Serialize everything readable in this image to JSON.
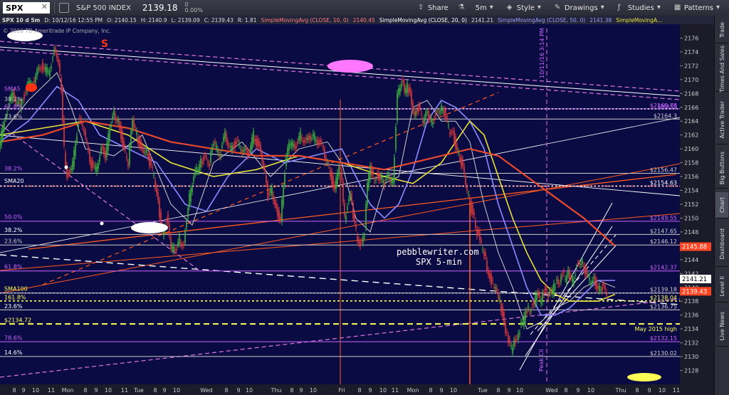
{
  "toolbar": {
    "symbol": "SPX",
    "index_name": "S&P 500 INDEX",
    "last_price": "2139.18",
    "change_abs": "0",
    "change_pct": "0.00%",
    "buttons": [
      {
        "label": "Share",
        "icon": "share-icon"
      },
      {
        "label": "",
        "icon": "flask-icon"
      },
      {
        "label": "5m",
        "icon": "timeframe-icon"
      },
      {
        "label": "Style",
        "icon": "style-icon"
      },
      {
        "label": "Drawings",
        "icon": "drawings-icon"
      },
      {
        "label": "Studies",
        "icon": "studies-icon"
      },
      {
        "label": "Patterns",
        "icon": "patterns-icon"
      }
    ]
  },
  "legend": {
    "title": "SPX 10 d 5m",
    "date": "D: 10/12/16 12:55 PM",
    "open": "O: 2140.15",
    "high": "H: 2140.9",
    "low": "L: 2139.09",
    "close": "C: 2139.43",
    "range": "R: 1.81",
    "sma10": "SimpleMovingAvg (CLOSE, 10, 0)",
    "sma10_val": "2140.45",
    "sma20": "SimpleMovingAvg (CLOSE, 20, 0)",
    "sma20_val": "2141.21",
    "sma50": "SimpleMovingAvg (CLOSE, 50, 0)",
    "sma50_val": "2141.38",
    "sma100": "SimpleMovingA...",
    "copyright": "© 2016 TD Ameritrade IP Company, Inc."
  },
  "sidebar_tabs": [
    "Trade",
    "Times And Sales",
    "Active Trader",
    "Big Buttons",
    "Chart",
    "Dashboard",
    "Level II",
    "Live News"
  ],
  "sidebar_active": "Chart",
  "annotations": {
    "s_label": "S",
    "watermark": "pebblewriter.com",
    "subtitle": "SPX 5-min",
    "vline_label": "10/11/16 3:14 PM",
    "peak_label": "Peak Cli",
    "fib_618_left": "61.8%",
    "fib_50_left": "50.0%",
    "fib_382_left": "38.2%",
    "fib_236_left": "23.6%",
    "fib_236_left_b": "23.6%",
    "fib_618_left_b": "61.8%",
    "fib_1618_left": "161.8%",
    "fib_786_left": "78.6%",
    "fib_146_left": "14.6%",
    "fib_382_left_b": "38.2%",
    "fib_236_left_c": "23.6%",
    "fib_382_left_c": "38.2%",
    "sma20_label": "SMA20",
    "sma100_label": "SMA100",
    "sma50_label": "SMA5",
    "sma50_label_b": "SMA50",
    "level_2134_left": "$2134.72",
    "may_high": "May 2015 high"
  },
  "colors": {
    "background": "#0e0e4e",
    "candle_up": "#3ab53a",
    "candle_down": "#e03a3a",
    "sma10": "#cccccc",
    "sma20": "#8a8cff",
    "sma50": "#e8e03a",
    "sma100": "#e84a2a",
    "fib": "#cc66ff",
    "accent_yellow": "#ffff55",
    "accent_orange": "#ff5a1e",
    "accent_pink": "#ff66ff"
  },
  "chart_data": {
    "type": "line",
    "title": "SPX 10 d 5m",
    "ylim": [
      2126,
      2178
    ],
    "y_ticks": [
      2128,
      2130,
      2132,
      2134,
      2136,
      2138,
      2140,
      2142,
      2144,
      2146,
      2148,
      2150,
      2152,
      2154,
      2156,
      2158,
      2160,
      2162,
      2164,
      2166,
      2168,
      2170,
      2172,
      2174,
      2176
    ],
    "x_ticks": [
      "8",
      "9",
      "10",
      "11",
      "Mon",
      "8",
      "9",
      "10",
      "11",
      "Tue",
      "8",
      "9",
      "10",
      "Wed",
      "8",
      "9",
      "10",
      "Thu",
      "8",
      "9",
      "10",
      "Fri",
      "8",
      "9",
      "10",
      "11",
      "Mon",
      "8",
      "9",
      "10",
      "Tue",
      "8",
      "9",
      "10",
      "Wed",
      "8",
      "9",
      "10",
      "Thu",
      "8",
      "9",
      "10",
      "11"
    ],
    "x_tick_pos": [
      20,
      33,
      50,
      72,
      95,
      120,
      135,
      152,
      175,
      195,
      218,
      231,
      248,
      290,
      318,
      335,
      350,
      388,
      410,
      423,
      440,
      480,
      505,
      520,
      538,
      555,
      580,
      605,
      620,
      637,
      678,
      700,
      715,
      730,
      775,
      795,
      812,
      830,
      872,
      895,
      912,
      930,
      950
    ],
    "price_series": {
      "name": "SPX",
      "x": [
        0,
        10,
        20,
        30,
        40,
        50,
        60,
        70,
        78,
        84,
        88,
        92,
        96,
        104,
        112,
        120,
        128,
        136,
        144,
        150,
        156,
        162,
        168,
        176,
        182,
        188,
        194,
        200,
        206,
        212,
        218,
        224,
        230,
        236,
        242,
        248,
        254,
        260,
        266,
        272,
        278,
        284,
        290,
        296,
        302,
        310,
        318,
        326,
        334,
        342,
        350,
        358,
        366,
        372,
        378,
        384,
        390,
        396,
        402,
        408,
        416,
        424,
        432,
        440,
        448,
        456,
        464,
        472,
        478,
        482,
        486,
        490,
        494,
        498,
        502,
        506,
        510,
        514,
        518,
        522,
        526,
        530,
        536,
        542,
        548,
        554,
        560,
        566,
        570,
        574,
        578,
        584,
        590,
        596,
        602,
        608,
        614,
        620,
        626,
        632,
        638,
        644,
        650,
        656,
        662,
        668,
        672,
        676,
        680,
        684,
        688,
        692,
        696,
        700,
        704,
        708,
        712,
        716,
        720,
        724,
        728,
        732,
        736,
        740,
        744,
        748,
        752,
        756,
        760,
        764,
        768,
        772,
        776,
        780,
        784,
        788,
        792,
        796,
        800,
        806,
        812,
        818,
        824,
        830,
        836,
        842,
        848,
        854,
        860,
        864
      ],
      "y": [
        2160,
        2165,
        2168,
        2166,
        2169,
        2170,
        2172,
        2171,
        2174,
        2173,
        2168,
        2160,
        2156,
        2158,
        2164,
        2163,
        2158,
        2157,
        2160,
        2159,
        2163,
        2165,
        2164,
        2160,
        2158,
        2164,
        2162,
        2160,
        2160,
        2158,
        2156,
        2152,
        2148,
        2150,
        2146,
        2145,
        2147,
        2146,
        2152,
        2155,
        2157,
        2158,
        2159,
        2158,
        2161,
        2159,
        2162,
        2160,
        2161,
        2160,
        2159,
        2162,
        2160,
        2158,
        2153,
        2154,
        2151,
        2150,
        2157,
        2161,
        2160,
        2162,
        2161,
        2162,
        2161,
        2160,
        2157,
        2154,
        2158,
        2155,
        2150,
        2152,
        2154,
        2150,
        2148,
        2146,
        2147,
        2148,
        2155,
        2157,
        2156,
        2156,
        2156,
        2155,
        2156,
        2155,
        2168,
        2170,
        2168,
        2169,
        2168,
        2165,
        2166,
        2164,
        2165,
        2164,
        2165,
        2166,
        2165,
        2163,
        2162,
        2160,
        2158,
        2155,
        2152,
        2150,
        2148,
        2147,
        2145,
        2144,
        2142,
        2141,
        2140,
        2139,
        2138,
        2136,
        2134,
        2132,
        2131,
        2132,
        2133,
        2134,
        2135,
        2136,
        2137,
        2137,
        2138,
        2139,
        2138,
        2139,
        2140,
        2139,
        2139,
        2140,
        2141,
        2141,
        2142,
        2141,
        2142,
        2141,
        2143,
        2144,
        2142,
        2141,
        2141,
        2140,
        2140,
        2139
      ]
    },
    "series": [
      {
        "name": "SMA10",
        "x": [
          0,
          40,
          80,
          100,
          120,
          160,
          200,
          240,
          270,
          300,
          340,
          380,
          420,
          460,
          480,
          500,
          520,
          540,
          560,
          580,
          600,
          620,
          640,
          660,
          680,
          700,
          720,
          740,
          760,
          780,
          800,
          820,
          840,
          864
        ],
        "y": [
          2162,
          2167,
          2171,
          2166,
          2160,
          2159,
          2162,
          2152,
          2149,
          2158,
          2161,
          2156,
          2160,
          2161,
          2158,
          2150,
          2148,
          2155,
          2156,
          2166,
          2167,
          2164,
          2164,
          2161,
          2152,
          2145,
          2140,
          2134,
          2135,
          2137,
          2138,
          2140,
          2141,
          2140
        ]
      },
      {
        "name": "SMA20",
        "x": [
          0,
          40,
          80,
          110,
          140,
          180,
          220,
          260,
          290,
          320,
          360,
          400,
          440,
          480,
          500,
          520,
          540,
          560,
          580,
          600,
          620,
          640,
          660,
          680,
          700,
          720,
          740,
          760,
          780,
          800,
          820,
          840,
          864
        ],
        "y": [
          2161,
          2164,
          2169,
          2167,
          2162,
          2160,
          2158,
          2152,
          2151,
          2156,
          2160,
          2158,
          2159,
          2160,
          2156,
          2152,
          2150,
          2152,
          2157,
          2164,
          2167,
          2166,
          2164,
          2160,
          2152,
          2146,
          2140,
          2136,
          2136,
          2137,
          2139,
          2141,
          2141
        ]
      },
      {
        "name": "SMA50",
        "x": [
          0,
          60,
          120,
          180,
          240,
          300,
          360,
          420,
          480,
          540,
          580,
          620,
          660,
          680,
          700,
          720,
          740,
          760,
          780,
          800,
          820,
          840,
          864
        ],
        "y": [
          2162,
          2163,
          2164,
          2162,
          2158,
          2156,
          2157,
          2159,
          2158,
          2156,
          2155,
          2158,
          2164,
          2162,
          2156,
          2150,
          2145,
          2141,
          2139,
          2138,
          2138,
          2138,
          2139
        ]
      },
      {
        "name": "SMA100",
        "x": [
          0,
          60,
          120,
          180,
          240,
          300,
          360,
          420,
          480,
          540,
          580,
          620,
          660,
          700,
          740,
          780,
          820,
          864
        ],
        "y": [
          2161,
          2162,
          2164,
          2163,
          2161,
          2160,
          2159,
          2159,
          2158,
          2157,
          2158,
          2159,
          2160,
          2159,
          2156,
          2153,
          2150,
          2146
        ]
      }
    ],
    "horizontal_levels": [
      {
        "label": "$2165.78",
        "value": 2165.78,
        "color": "#cc66ff"
      },
      {
        "label": "$2164.3",
        "value": 2164.3,
        "color": "#cccccc"
      },
      {
        "label": "$2156.47",
        "value": 2156.47,
        "color": "#cccccc"
      },
      {
        "label": "$2154.63",
        "value": 2154.63,
        "color": "#ff6666"
      },
      {
        "label": "$2149.55",
        "value": 2149.55,
        "color": "#cc66ff"
      },
      {
        "label": "$2147.65",
        "value": 2147.65,
        "color": "#cccccc"
      },
      {
        "label": "$2146.12",
        "value": 2146.12,
        "color": "#cccccc"
      },
      {
        "label": "$2142.37",
        "value": 2142.37,
        "color": "#cc66ff"
      },
      {
        "label": "$2139.18",
        "value": 2139.18,
        "color": "#cccccc"
      },
      {
        "label": "$2138.04",
        "value": 2138.04,
        "color": "#ffff55"
      },
      {
        "label": "$2136.75",
        "value": 2136.75,
        "color": "#cccccc"
      },
      {
        "label": "$2132.15",
        "value": 2132.15,
        "color": "#cc66ff"
      },
      {
        "label": "$2130.02",
        "value": 2130.02,
        "color": "#cccccc"
      }
    ],
    "price_badges": [
      {
        "label": "2145.88",
        "value": 2145.88,
        "color": "#ff4422"
      },
      {
        "label": "2141.21",
        "value": 2141.21,
        "color": "#ffffff"
      },
      {
        "label": "2139.43",
        "value": 2139.43,
        "color": "#ff4422"
      }
    ]
  }
}
